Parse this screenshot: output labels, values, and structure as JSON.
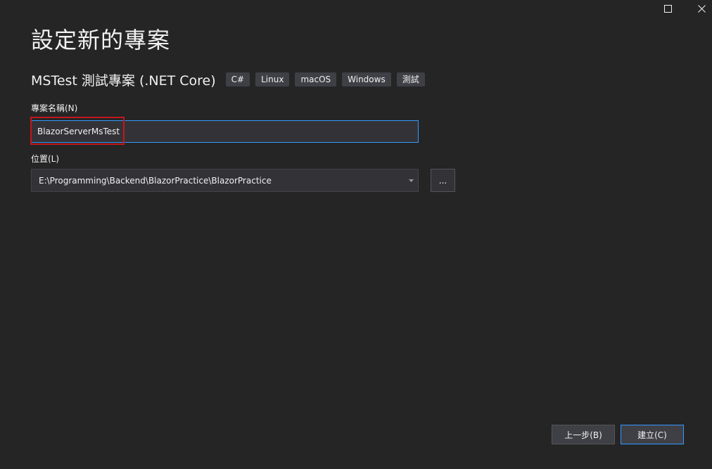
{
  "dialog": {
    "title": "設定新的專案"
  },
  "template": {
    "name": "MSTest 測試專案 (.NET Core)",
    "tags": [
      "C#",
      "Linux",
      "macOS",
      "Windows",
      "測試"
    ]
  },
  "project_name": {
    "label": "專案名稱(N)",
    "value": "BlazorServerMsTest"
  },
  "location": {
    "label": "位置(L)",
    "value": "E:\\Programming\\Backend\\BlazorPractice\\BlazorPractice",
    "browse_label": "..."
  },
  "footer": {
    "back_label": "上一步(B)",
    "create_label": "建立(C)"
  },
  "colors": {
    "background": "#252526",
    "accent": "#3399ff",
    "highlight": "#c4161c"
  },
  "icons": {
    "maximize": "maximize-icon",
    "close": "close-icon",
    "dropdown": "chevron-down-icon"
  }
}
